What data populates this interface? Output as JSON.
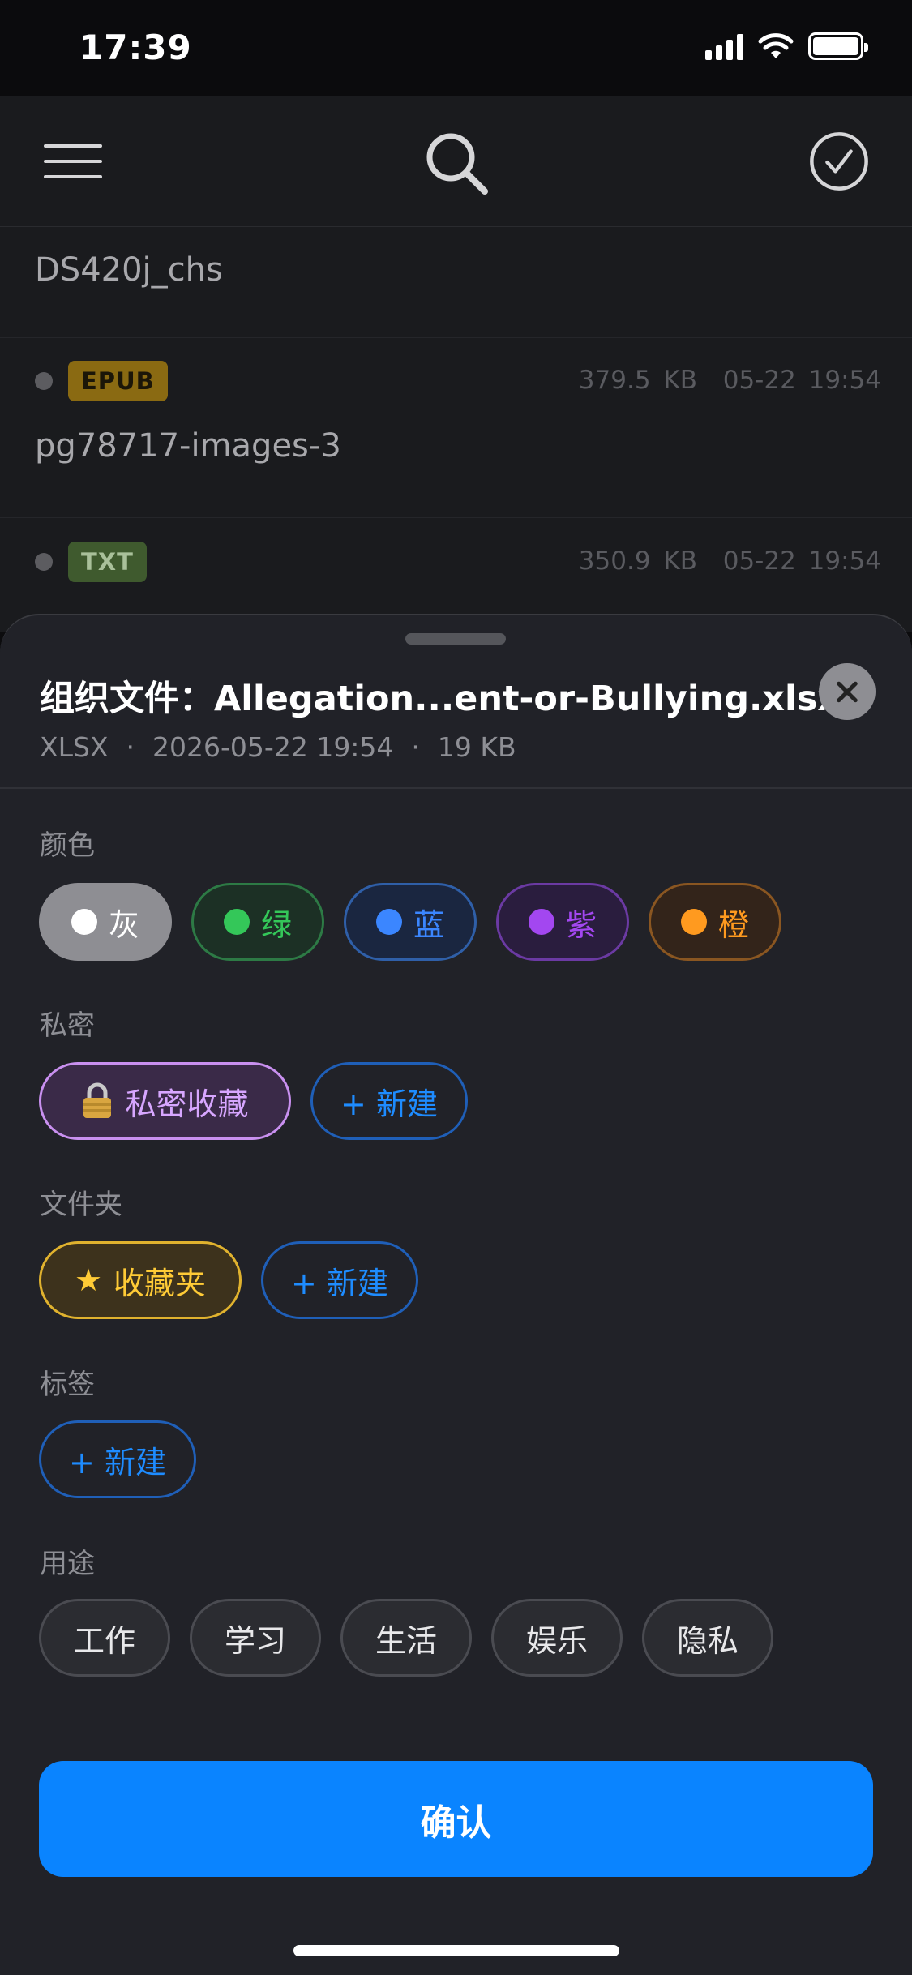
{
  "status_bar": {
    "time": "17:39"
  },
  "file_list": [
    {
      "name": "DS420j_chs"
    },
    {
      "type": "EPUB",
      "size": "379.5 KB",
      "date": "05-22 19:54",
      "name": "pg78717-images-3"
    },
    {
      "type": "TXT",
      "size": "350.9 KB",
      "date": "05-22 19:54"
    }
  ],
  "sheet": {
    "title": "组织文件：Allegation...ent-or-Bullying.xlsx",
    "subtitle": {
      "type": "XLSX",
      "date": "2026-05-22 19:54",
      "size": "19 KB",
      "separator": "·"
    },
    "color_section": {
      "label": "颜色",
      "options": [
        {
          "label": "灰",
          "color": "#ffffff"
        },
        {
          "label": "绿",
          "color": "#34c759"
        },
        {
          "label": "蓝",
          "color": "#3b86ff"
        },
        {
          "label": "紫",
          "color": "#a347f0"
        },
        {
          "label": "橙",
          "color": "#ff9a1f"
        }
      ]
    },
    "private_section": {
      "label": "私密",
      "item": "私密收藏",
      "new_label": "+ 新建"
    },
    "folder_section": {
      "label": "文件夹",
      "item": "收藏夹",
      "new_label": "+ 新建"
    },
    "tag_section": {
      "label": "标签",
      "new_label": "+ 新建"
    },
    "usage_section": {
      "label": "用途",
      "options": [
        "工作",
        "学习",
        "生活",
        "娱乐",
        "隐私"
      ]
    },
    "confirm_label": "确认"
  }
}
